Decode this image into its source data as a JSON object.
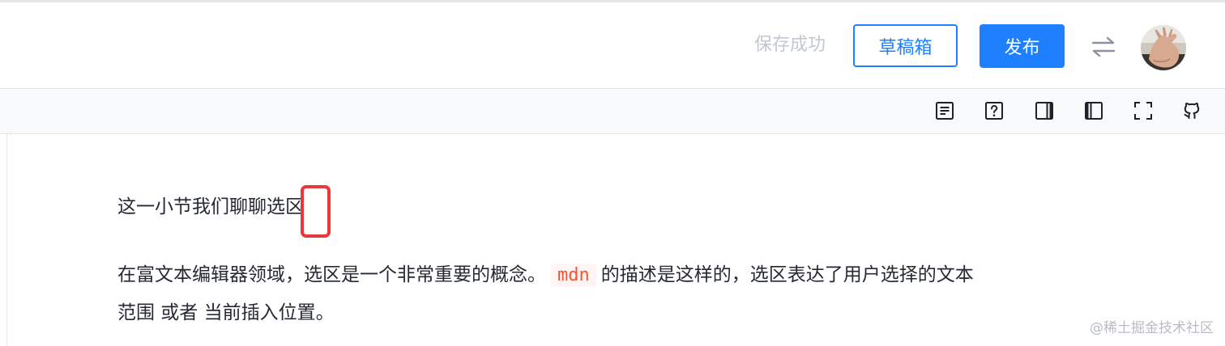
{
  "header": {
    "save_status": "保存成功",
    "drafts_label": "草稿箱",
    "publish_label": "发布",
    "switch_icon": "switch-arrows-icon",
    "avatar_icon": "user-avatar"
  },
  "toolbar": {
    "tools": [
      {
        "name": "contents-icon"
      },
      {
        "name": "help-icon"
      },
      {
        "name": "preview-only-icon"
      },
      {
        "name": "editor-only-icon"
      },
      {
        "name": "fullscreen-icon"
      },
      {
        "name": "github-icon"
      }
    ]
  },
  "editor": {
    "para1": "这一小节我们聊聊选区",
    "para2_before": "在富文本编辑器领域，选区是一个非常重要的概念。",
    "para2_code": "mdn",
    "para2_after": "的描述是这样的，选区表达了用户选择的文本",
    "para3": "范围 或者 当前插入位置。"
  },
  "watermark": "@稀土掘金技术社区",
  "colors": {
    "accent": "#1e80ff",
    "highlight_box": "#e8383d",
    "code_text": "#ff502c"
  }
}
